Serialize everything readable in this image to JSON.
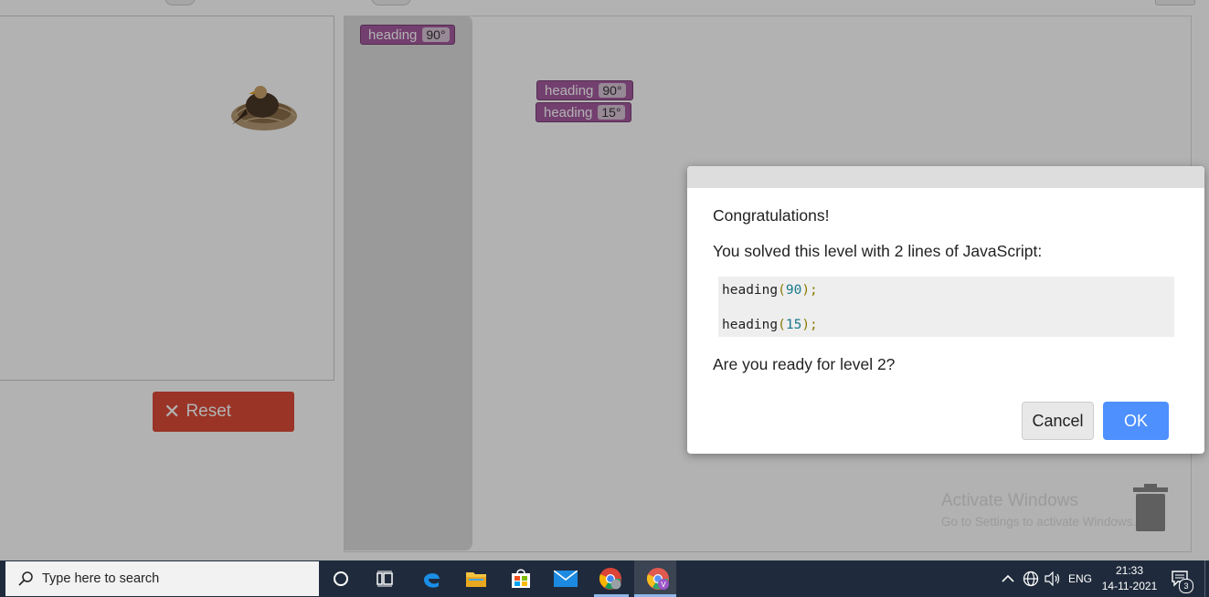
{
  "game": {
    "reset_label": "Reset",
    "flyout_block": {
      "label": "heading",
      "value": "90°"
    },
    "workspace_blocks": [
      {
        "label": "heading",
        "value": "90°"
      },
      {
        "label": "heading",
        "value": "15°"
      }
    ]
  },
  "dialog": {
    "title": "Congratulations!",
    "message": "You solved this level with 2 lines of JavaScript:",
    "code": {
      "line1": {
        "fn": "heading",
        "open": "(",
        "arg": "90",
        "close": ");"
      },
      "line2": {
        "fn": "heading",
        "open": "(",
        "arg": "15",
        "close": ");"
      }
    },
    "question": "Are you ready for level 2?",
    "cancel_label": "Cancel",
    "ok_label": "OK"
  },
  "watermark": {
    "title": "Activate Windows",
    "subtitle": "Go to Settings to activate Windows."
  },
  "taskbar": {
    "search_placeholder": "Type here to search",
    "language": "ENG",
    "time": "21:33",
    "date": "14-11-2021",
    "notification_count": "3"
  },
  "colors": {
    "block": "#a55b9f",
    "reset": "#dd4b39",
    "ok_button": "#4d90fe",
    "taskbar": "#1f2b3c"
  }
}
